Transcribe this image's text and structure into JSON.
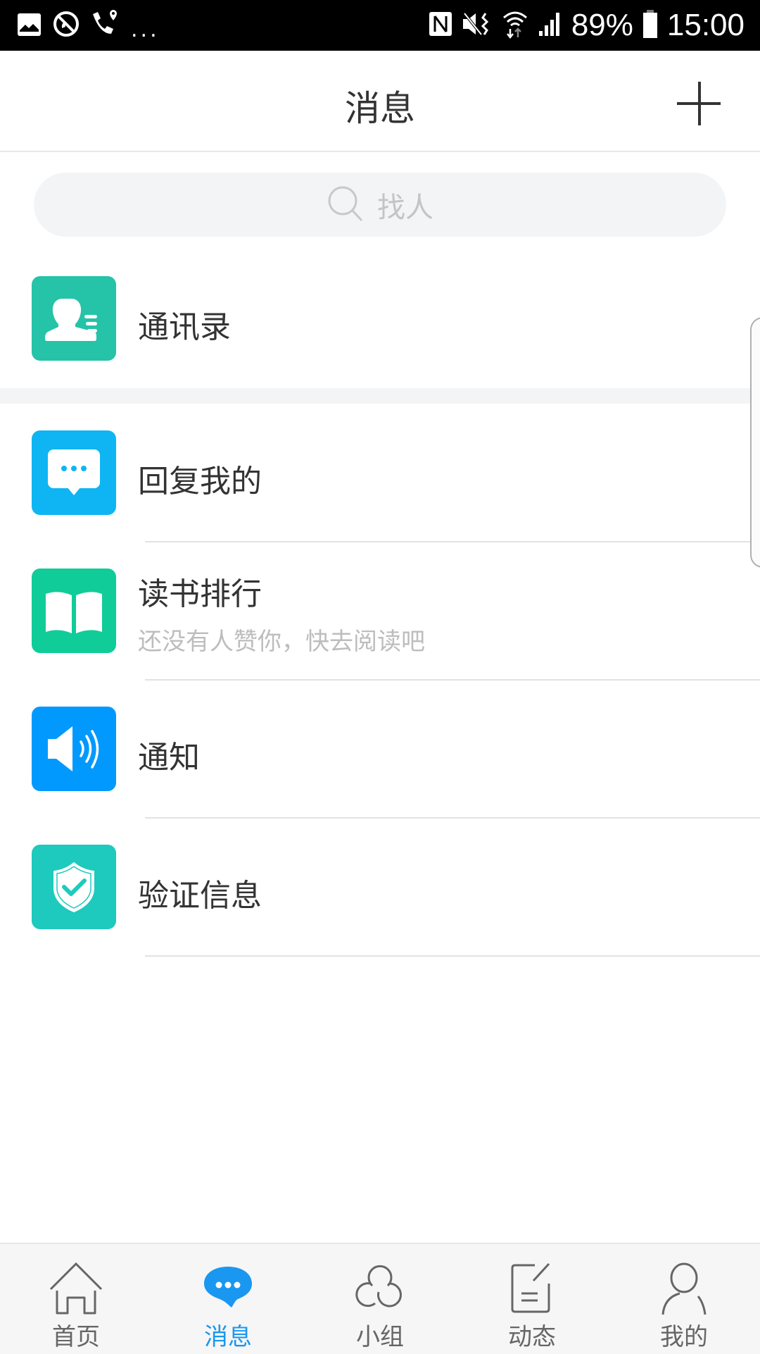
{
  "status_bar": {
    "left_icons": [
      "gallery-icon",
      "call-blocked-icon",
      "wifi-call-location-icon",
      "more-notifications-icon"
    ],
    "more_indicator": "...",
    "right_icons": [
      "nfc-icon",
      "mute-vibrate-icon",
      "wifi-icon",
      "signal-icon",
      "battery-icon"
    ],
    "battery": "89%",
    "time": "15:00"
  },
  "header": {
    "title": "消息",
    "add_button_icon": "plus-icon"
  },
  "search": {
    "icon": "search-icon",
    "placeholder": "找人"
  },
  "contacts": {
    "label": "通讯录",
    "icon": "contacts-icon",
    "color": "#25c3a8"
  },
  "messages": [
    {
      "label": "回复我的",
      "subtitle": "",
      "icon": "chat-bubble-icon",
      "color": "#0fb5f3"
    },
    {
      "label": "读书排行",
      "subtitle": "还没有人赞你，快去阅读吧",
      "icon": "book-icon",
      "color": "#10cc98"
    },
    {
      "label": "通知",
      "subtitle": "",
      "icon": "speaker-icon",
      "color": "#0199fe"
    },
    {
      "label": "验证信息",
      "subtitle": "",
      "icon": "shield-check-icon",
      "color": "#1dcabd"
    }
  ],
  "bottom_nav": {
    "active_color": "#1a97f0",
    "items": [
      {
        "label": "首页",
        "icon": "home-icon",
        "active": false
      },
      {
        "label": "消息",
        "icon": "message-icon",
        "active": true
      },
      {
        "label": "小组",
        "icon": "group-icon",
        "active": false
      },
      {
        "label": "动态",
        "icon": "post-icon",
        "active": false
      },
      {
        "label": "我的",
        "icon": "profile-icon",
        "active": false
      }
    ]
  }
}
